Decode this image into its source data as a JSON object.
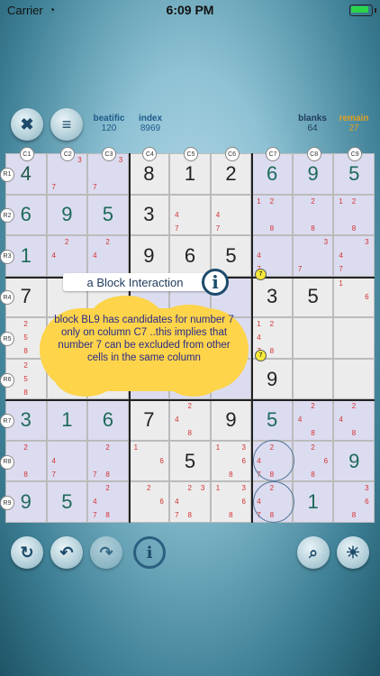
{
  "status": {
    "carrier": "Carrier",
    "time": "6:09 PM"
  },
  "header": {
    "beatific_label": "beatific",
    "beatific_value": "120",
    "index_label": "index",
    "index_value": "8969",
    "blanks_label": "blanks",
    "blanks_value": "64",
    "remain_label": "remain",
    "remain_value": "27",
    "colors": {
      "blue": "#1d5a8a",
      "orange": "#e0a020"
    }
  },
  "columns": [
    "C1",
    "C2",
    "C3",
    "C4",
    "C5",
    "C6",
    "C7",
    "C8",
    "C9"
  ],
  "rows": [
    "R1",
    "R2",
    "R3",
    "R4",
    "R5",
    "R6",
    "R7",
    "R8",
    "R9"
  ],
  "board": [
    [
      "4",
      "",
      "",
      "8",
      "1",
      "2",
      "6",
      "9",
      "5"
    ],
    [
      "6",
      "9",
      "5",
      "3",
      "",
      "",
      "",
      "",
      ""
    ],
    [
      "1",
      "",
      "",
      "9",
      "6",
      "5",
      "",
      "",
      ""
    ],
    [
      "7",
      "",
      "",
      "",
      "",
      "",
      "3",
      "5",
      ""
    ],
    [
      "",
      "",
      "",
      "",
      "",
      "",
      "",
      "",
      ""
    ],
    [
      "",
      "",
      "",
      "",
      "",
      "",
      "9",
      "",
      ""
    ],
    [
      "3",
      "1",
      "6",
      "7",
      "",
      "9",
      "5",
      "",
      ""
    ],
    [
      "",
      "",
      "",
      "",
      "5",
      "",
      "",
      "",
      "9"
    ],
    [
      "9",
      "5",
      "",
      "",
      "",
      "",
      "",
      "1",
      ""
    ]
  ],
  "candidates": {
    "r1c2": "3 7",
    "r1c3": "3 7",
    "r2c5": "4 7",
    "r2c6": "4 7",
    "r2c7": "1 2 8",
    "r2c8": "2 8",
    "r2c9": "1 2 8",
    "r3c2": "2 4",
    "r3c3": "2 4",
    "r3c7": "4 7",
    "r3c8": "3 7",
    "r3c9": "3 4 7",
    "r4c9": "1 6",
    "r5c1": "2 5 8",
    "r5c7": "1 2 4 7 8",
    "r6c1": "2 5 8",
    "r6c7": "",
    "r7c5": "2 4 8",
    "r7c8": "2 4 8",
    "r7c9": "2 4 8",
    "r8c1": "2 8",
    "r8c2": "4 7",
    "r8c3": "2 7 8",
    "r8c4": "1 6",
    "r8c6": "1 3 6 8",
    "r8c7": "2 4 7 8",
    "r8c8": "2 6 8",
    "r9c3": "2 4 7 8",
    "r9c4": "2 6",
    "r9c5": "2 3 4 7 8",
    "r9c6": "1 3 6 8",
    "r9c7": "2 4 7 8",
    "r9c9": "3 6 8"
  },
  "tip": {
    "title": "a Block Interaction",
    "text": "block BL9 has candidates for number 7 only on column C7 ..this implies that number 7 can be excluded from other cells in the same column"
  },
  "marks": {
    "seven": "7"
  },
  "icons": {
    "close": "close-icon",
    "menu": "menu-icon",
    "refresh": "refresh-icon",
    "undo": "undo-icon",
    "redo": "redo-icon",
    "info": "info-icon",
    "search": "search-icon",
    "hint": "lightbulb-icon"
  }
}
